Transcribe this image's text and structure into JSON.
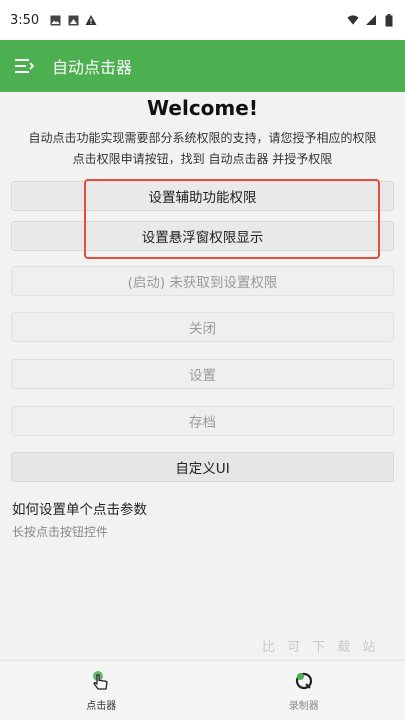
{
  "status_bar": {
    "time": "3:50"
  },
  "app_bar": {
    "title": "自动点击器"
  },
  "main": {
    "welcome": "Welcome!",
    "intro_line1": "自动点击功能实现需要部分系统权限的支持，请您授予相应的权限",
    "intro_line2": "点击权限申请按钮，找到 自动点击器 并授予权限",
    "buttons": {
      "accessibility": "设置辅助功能权限",
      "overlay": "设置悬浮窗权限显示",
      "start": "(启动) 未获取到设置权限",
      "close": "关闭",
      "settings": "设置",
      "archive": "存档",
      "custom_ui": "自定义UI"
    },
    "howto_title": "如何设置单个点击参数",
    "howto_desc": "长按点击按钮控件",
    "watermark": "比 可 下 载 站"
  },
  "bottom_nav": {
    "items": [
      {
        "label": "点击器",
        "icon": "hand-pointer-icon"
      },
      {
        "label": "录制器",
        "icon": "record-icon"
      }
    ]
  },
  "colors": {
    "primary": "#4caf50",
    "highlight": "#e0503c"
  }
}
